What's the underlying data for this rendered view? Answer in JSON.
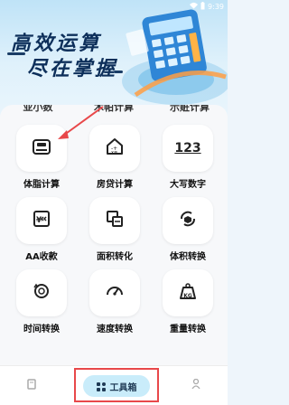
{
  "status_bar": {
    "time": "9:39"
  },
  "banner": {
    "line1": "高效运算",
    "line2": "尽在掌握"
  },
  "partial_row": [
    "亚小数",
    "木帕计算",
    "示赃计算"
  ],
  "tools": [
    {
      "label": "体脂计算",
      "icon": "scale-icon"
    },
    {
      "label": "房贷计算",
      "icon": "house-calc-icon"
    },
    {
      "label": "大写数字",
      "icon": "number-123-icon",
      "glyph": "123"
    },
    {
      "label": "AA收款",
      "icon": "yen-receipt-icon"
    },
    {
      "label": "面积转化",
      "icon": "area-convert-icon"
    },
    {
      "label": "体积转换",
      "icon": "volume-convert-icon"
    },
    {
      "label": "时间转换",
      "icon": "clock-convert-icon"
    },
    {
      "label": "速度转换",
      "icon": "speedometer-icon"
    },
    {
      "label": "重量转换",
      "icon": "weight-kg-icon",
      "glyph": "KG"
    }
  ],
  "navbar": {
    "active_label": "工具箱"
  },
  "colors": {
    "highlight_red": "#e8484a",
    "pill": "#c9ecfa",
    "brand_dark": "#0d2f5a"
  }
}
